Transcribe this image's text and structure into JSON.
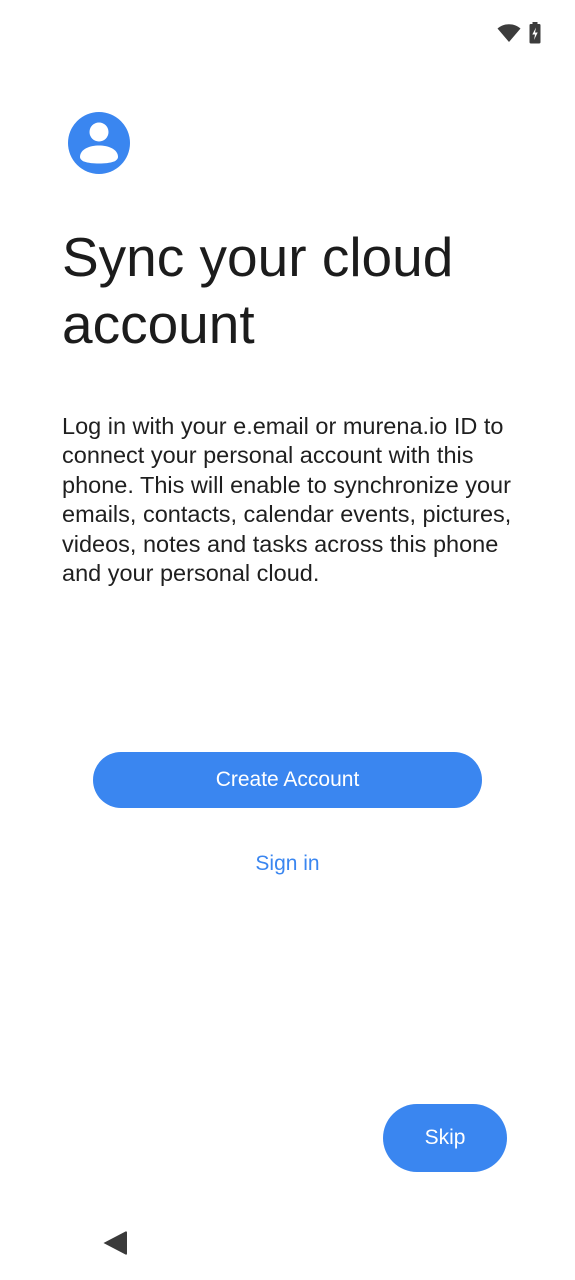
{
  "status_bar": {
    "icons": [
      "wifi-icon",
      "battery-charging-icon"
    ]
  },
  "header": {
    "icon": "account-circle-icon",
    "title": "Sync your cloud account"
  },
  "body": {
    "description": "Log in with your e.email or murena.io ID to connect your personal account with this phone. This will enable to synchronize your emails, contacts, calendar events, pictures, videos, notes and tasks across this phone and your personal cloud."
  },
  "actions": {
    "create_account_label": "Create Account",
    "sign_in_label": "Sign in",
    "skip_label": "Skip"
  },
  "nav_bar": {
    "icons": [
      "back-triangle-icon"
    ]
  },
  "colors": {
    "accent": "#3a86f0",
    "text": "#1c1c1c",
    "background": "#ffffff"
  }
}
